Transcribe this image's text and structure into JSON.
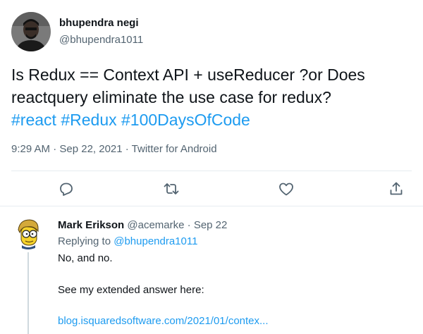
{
  "tweet": {
    "author_name": "bhupendra negi",
    "author_handle": "@bhupendra1011",
    "text_line1": "Is Redux == Context API + useReducer ?or Does",
    "text_line2": "reactquery eliminate the use case for redux?",
    "hashtags": [
      "#react",
      "#Redux",
      "#100DaysOfCode"
    ],
    "meta": "9:29 AM · Sep 22, 2021 · Twitter for Android",
    "actions": [
      {
        "name": "reply",
        "icon": "reply-icon"
      },
      {
        "name": "retweet",
        "icon": "retweet-icon"
      },
      {
        "name": "like",
        "icon": "heart-icon"
      },
      {
        "name": "share",
        "icon": "share-icon"
      }
    ]
  },
  "reply": {
    "author_name": "Mark Erikson",
    "author_handle": "@acemarke",
    "separator": "·",
    "date": "Sep 22",
    "replying_prefix": "Replying to",
    "replying_mention": "@bhupendra1011",
    "line1": "No, and no.",
    "line2": "See my extended answer here:",
    "link": "blog.isquaredsoftware.com/2021/01/contex..."
  },
  "colors": {
    "link": "#1d9bf0",
    "secondary_text": "#536471",
    "divider": "#e6ecf0",
    "thread_line": "#cfd9de"
  }
}
